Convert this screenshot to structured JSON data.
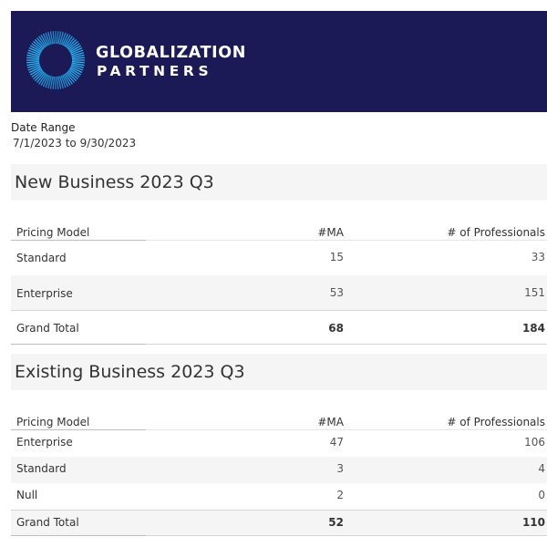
{
  "header": {
    "logo_line1": "GLOBALIZATION",
    "logo_line2": "PARTNERS",
    "brand_color": "#1b1a56",
    "accent_color": "#29b6f6",
    "logo_icon": "ring-logo-icon"
  },
  "filter": {
    "label": "Date Range",
    "value": "7/1/2023 to 9/30/2023"
  },
  "new_business": {
    "title": "New Business 2023 Q3",
    "columns": [
      "Pricing Model",
      "#MA",
      "# of Professionals"
    ],
    "rows": [
      {
        "model": "Standard",
        "ma": "15",
        "pros": "33"
      },
      {
        "model": "Enterprise",
        "ma": "53",
        "pros": "151"
      }
    ],
    "total": {
      "model": "Grand Total",
      "ma": "68",
      "pros": "184"
    }
  },
  "existing_business": {
    "title": "Existing Business 2023 Q3",
    "columns": [
      "Pricing Model",
      "#MA",
      "# of Professionals"
    ],
    "rows": [
      {
        "model": "Enterprise",
        "ma": "47",
        "pros": "106"
      },
      {
        "model": "Standard",
        "ma": "3",
        "pros": "4"
      },
      {
        "model": "Null",
        "ma": "2",
        "pros": "0"
      }
    ],
    "total": {
      "model": "Grand Total",
      "ma": "52",
      "pros": "110"
    }
  }
}
